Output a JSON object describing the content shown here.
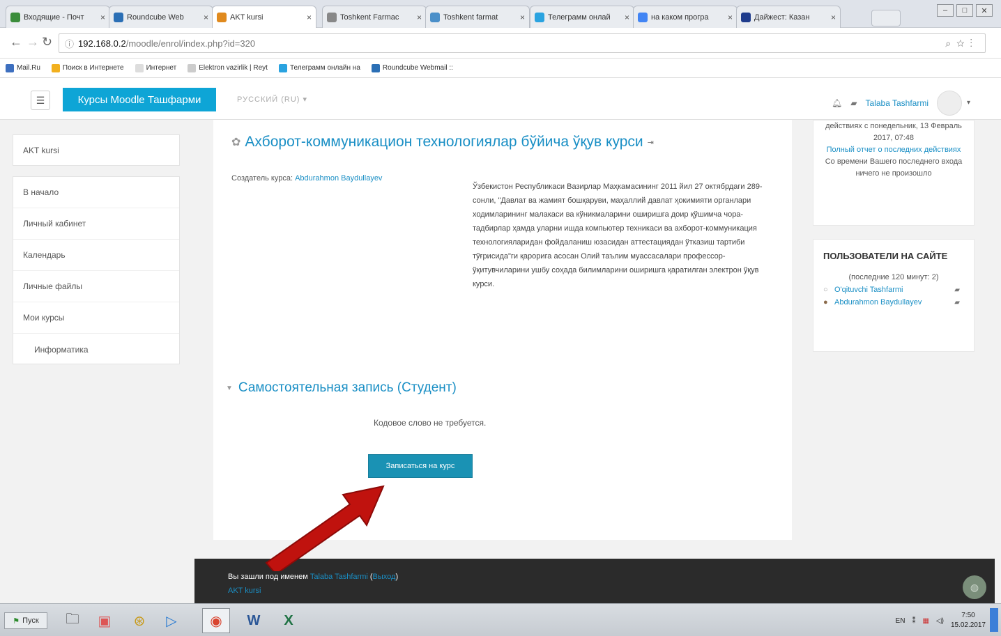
{
  "browser": {
    "tabs": [
      {
        "title": "Входящие - Почт",
        "icon_color": "#3b8d3b",
        "active": false
      },
      {
        "title": "Roundcube Web",
        "icon_color": "#2b6fb5",
        "active": false
      },
      {
        "title": "AKT kursi",
        "icon_color": "#e08a1e",
        "active": true
      },
      {
        "title": "Toshkent Farmac",
        "icon_color": "#888888",
        "active": false
      },
      {
        "title": "Toshkent farmat",
        "icon_color": "#4a8fc9",
        "active": false
      },
      {
        "title": "Телеграмм онлай",
        "icon_color": "#2aa3e0",
        "active": false
      },
      {
        "title": "на каком програ",
        "icon_color": "#4285f4",
        "active": false
      },
      {
        "title": "Дайжест: Казан",
        "icon_color": "#1f3c8c",
        "active": false
      }
    ],
    "url_host": "192.168.0.2",
    "url_path": "/moodle/enrol/index.php?id=320",
    "bookmarks": [
      {
        "label": "Mail.Ru",
        "color": "#3d6fbf"
      },
      {
        "label": "Поиск в Интернете",
        "color": "#f2b01e"
      },
      {
        "label": "Интернет",
        "color": "#dddddd"
      },
      {
        "label": "Elektron vazirlik | Reyt",
        "color": "#cccccc"
      },
      {
        "label": "Телеграмм онлайн на",
        "color": "#2aa3e0"
      },
      {
        "label": "Roundcube Webmail ::",
        "color": "#2b6fb5"
      }
    ]
  },
  "navbar": {
    "brand": "Курсы Moodle Ташфарми",
    "lang": "РУССКИЙ (RU) ▾",
    "user": "Talaba Tashfarmi"
  },
  "left": {
    "course": "AKT kursi",
    "items": [
      "В начало",
      "Личный кабинет",
      "Календарь",
      "Личные файлы",
      "Мои курсы"
    ],
    "sub": "Информатика"
  },
  "main": {
    "title": "Ахборот-коммуникацион технологиялар бўйича ўқув курси",
    "creator_label": "Создатель курса:",
    "creator_name": "Abdurahmon Baydullayev",
    "summary": "Ўзбекистон Республикаси Вазирлар Маҳкамасининг 2011 йил 27 октябрдаги 289-сонли, \"Давлат ва жамият бошқаруви, маҳаллий давлат ҳокимияти органлари ходимларининг малакаси ва кўникмаларини оширишга доир қўшимча чора-тадбирлар ҳамда уларни ишда компьютер техникаси ва ахборот-коммуникация технологияларидан фойдаланиш юзасидан аттестациядан ўтказиш тартиби тўғрисида\"ги қарорига асосан Олий таълим муассасалари профессор-ўқитувчиларини ушбу соҳада билимларини оширишга қаратилган электрон ўқув курси.",
    "section": "Самостоятельная запись (Студент)",
    "nokey": "Кодовое слово не требуется.",
    "enrol": "Записаться на курс"
  },
  "right": {
    "activity_text": "действиях с понедельник, 13 Февраль 2017, 07:48",
    "activity_link": "Полный отчет о последних действиях",
    "activity_none": "Со времени Вашего последнего входа ничего не произошло",
    "online_title": "ПОЛЬЗОВАТЕЛИ НА САЙТЕ",
    "online_period": "(последние 120 минут: 2)",
    "online_users": [
      "O'qituvchi Tashfarmi",
      "Abdurahmon Baydullayev"
    ]
  },
  "footer": {
    "logged_prefix": "Вы зашли под именем",
    "user": "Talaba Tashfarmi",
    "logout": "Выход",
    "course": "AKT kursi"
  },
  "taskbar": {
    "start": "Пуск",
    "lang": "EN",
    "time": "7:50",
    "date": "15.02.2017"
  }
}
